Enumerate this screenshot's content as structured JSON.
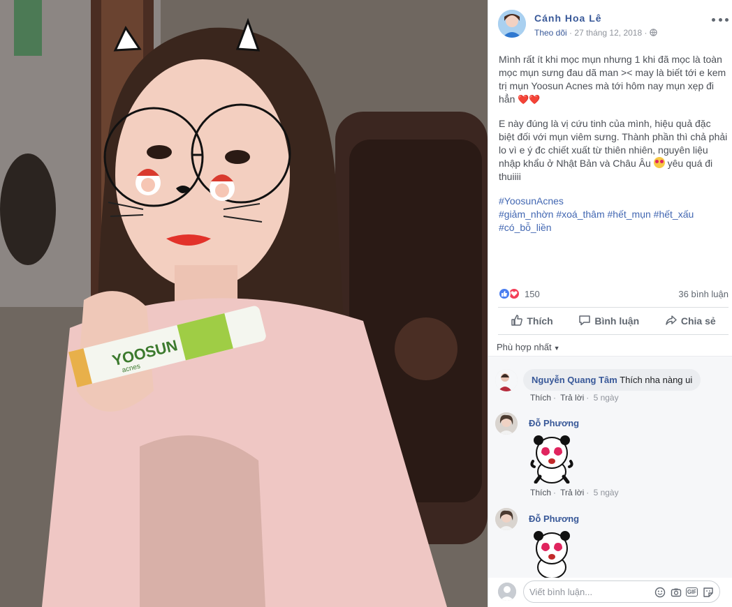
{
  "post": {
    "author": "Cánh Hoa Lê",
    "follow_label": "Theo dõi",
    "meta_separator": "·",
    "date": "27 tháng 12, 2018",
    "privacy_icon": "globe-icon",
    "paragraph1": "Mình rất ít khi mọc mụn nhưng 1 khi đã mọc là toàn mọc mụn sưng đau dã man >< may là biết tới e kem trị mụn Yoosun Acnes mà tới hôm nay mụn xẹp đi hẳn",
    "paragraph1_hearts": "❤️❤️",
    "paragraph2": "E này đúng là vị cứu tinh của mình, hiệu quả đặc biệt đối với mụn viêm sưng. Thành phần thì chả phải lo vì e ý đc chiết xuất từ thiên nhiên, nguyên liệu nhập khẩu ở Nhật Bản và Châu Âu",
    "paragraph2_tail": "yêu quá đi thuiiii",
    "hashtag1": "#YoosunAcnes",
    "hashtag2": "#giảm_nhờn #xoá_thâm #hết_mụn #hết_xấu",
    "hashtag3": "#có_bỗ_liền"
  },
  "reactions": {
    "count": "150",
    "comments": "36 bình luận"
  },
  "actions": {
    "like": "Thích",
    "comment": "Bình luận",
    "share": "Chia sẻ"
  },
  "sort_label": "Phù hợp nhất",
  "comments": [
    {
      "name": "Nguyễn Quang Tâm",
      "text": "Thích nha nàng ui",
      "like": "Thích",
      "reply": "Trả lời",
      "time": "5 ngày"
    },
    {
      "name": "Đỗ Phương",
      "like": "Thích",
      "reply": "Trả lời",
      "time": "5 ngày"
    },
    {
      "name": "Đỗ Phương"
    }
  ],
  "separator": "·",
  "composer": {
    "placeholder": "Viết bình luận...",
    "gif_label": "GIF"
  },
  "photo": {
    "product_brand": "YOOSUN",
    "product_sub": "acnes"
  },
  "colors": {
    "link": "#385898",
    "hashtag": "#4267b2",
    "love": "#f33e58",
    "like": "#4a7ef0"
  }
}
